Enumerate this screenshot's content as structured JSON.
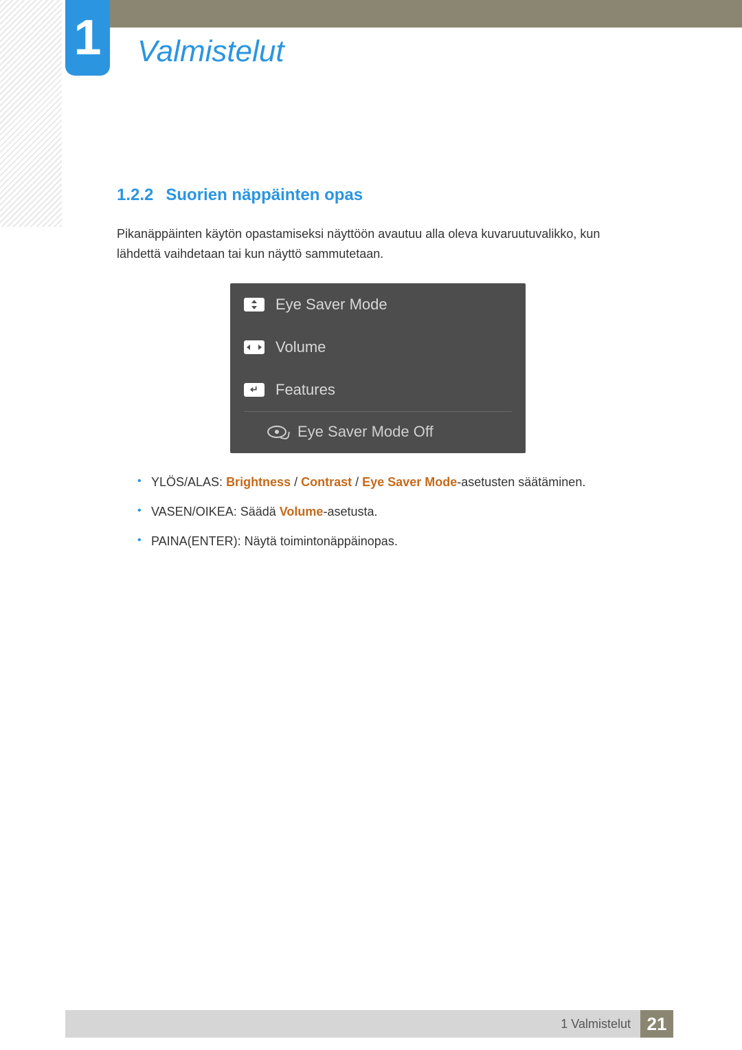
{
  "chapter": {
    "number": "1",
    "title": "Valmistelut"
  },
  "section": {
    "number": "1.2.2",
    "title": "Suorien näppäinten opas"
  },
  "intro": "Pikanäppäinten käytön opastamiseksi näyttöön avautuu alla oleva kuvaruutuvalikko, kun lähdettä vaihdetaan tai kun näyttö sammutetaan.",
  "osd": {
    "rows": [
      {
        "icon": "updown",
        "label": "Eye Saver Mode"
      },
      {
        "icon": "leftright",
        "label": "Volume"
      },
      {
        "icon": "enter",
        "label": "Features"
      }
    ],
    "status": "Eye Saver Mode Off"
  },
  "bullets": [
    {
      "prefix": "YLÖS/ALAS: ",
      "hl1": "Brightness",
      "sep1": " / ",
      "hl2": "Contrast",
      "sep2": " / ",
      "hl3": "Eye Saver Mode",
      "suffix": "-asetusten säätäminen."
    },
    {
      "prefix": "VASEN/OIKEA: Säädä ",
      "hl1": "Volume",
      "suffix": "-asetusta."
    },
    {
      "prefix": "PAINA(ENTER): Näytä toimintonäppäinopas."
    }
  ],
  "footer": {
    "label": "1 Valmistelut",
    "page": "21"
  }
}
